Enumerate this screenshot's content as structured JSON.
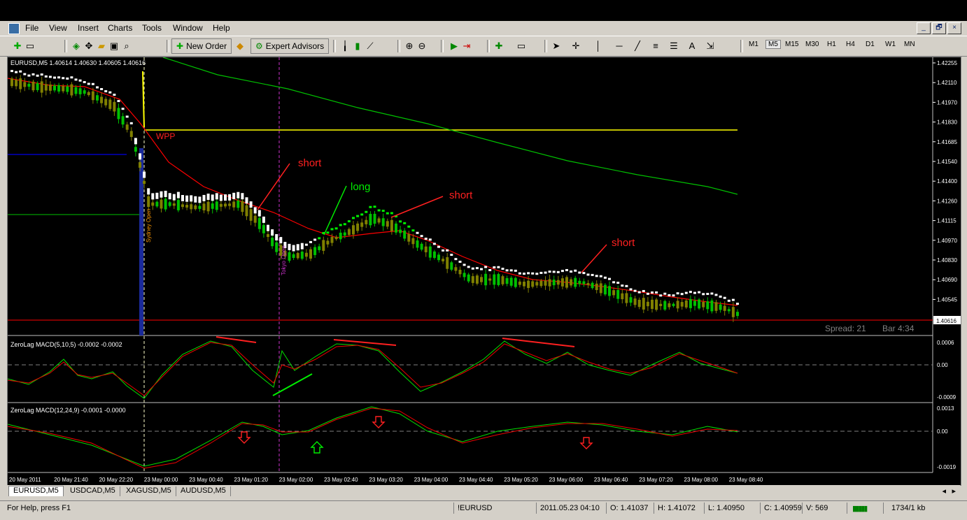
{
  "menu": [
    "File",
    "View",
    "Insert",
    "Charts",
    "Tools",
    "Window",
    "Help"
  ],
  "window_buttons": [
    "_",
    "🗗",
    "×"
  ],
  "toolbar": {
    "new_order": "New Order",
    "expert_advisors": "Expert Advisors",
    "timeframes": [
      "M1",
      "M5",
      "M15",
      "M30",
      "H1",
      "H4",
      "D1",
      "W1",
      "MN"
    ],
    "active_timeframe": "M5"
  },
  "chart": {
    "header": "EURUSD,M5  1.40614 1.40630 1.40605 1.40616",
    "price_labels": [
      "1.42255",
      "1.42110",
      "1.41970",
      "1.41830",
      "1.41685",
      "1.41540",
      "1.41400",
      "1.41260",
      "1.41115",
      "1.40970",
      "1.40830",
      "1.40690",
      "1.40545"
    ],
    "current_price": "1.40616",
    "spread_text": "Spread: 21",
    "bar_text": "Bar  4:34",
    "wpp_label": "WPP",
    "session_labels": [
      "Sydney Open",
      "Tokyo Open"
    ],
    "annotations": [
      "short",
      "long",
      "short",
      "short"
    ],
    "macd1_header": "ZeroLag MACD(5,10,5) -0.0002 -0.0002",
    "macd1_levels": [
      "0.0006",
      "0.00",
      "-0.0009"
    ],
    "macd2_header": "ZeroLag MACD(12,24,9) -0.0001 -0.0000",
    "macd2_levels": [
      "0.0013",
      "0.00",
      "-0.0019"
    ],
    "time_labels": [
      "20 May 2011",
      "20 May 21:40",
      "20 May 22:20",
      "23 May 00:00",
      "23 May 00:40",
      "23 May 01:20",
      "23 May 02:00",
      "23 May 02:40",
      "23 May 03:20",
      "23 May 04:00",
      "23 May 04:40",
      "23 May 05:20",
      "23 May 06:00",
      "23 May 06:40",
      "23 May 07:20",
      "23 May 08:00",
      "23 May 08:40"
    ]
  },
  "tabs": [
    "EURUSD,M5",
    "USDCAD,M5",
    "XAGUSD,M5",
    "AUDUSD,M5"
  ],
  "status": {
    "help": "For Help, press F1",
    "profile": "!EURUSD",
    "datetime": "2011.05.23 04:10",
    "open": "O: 1.41037",
    "high": "H: 1.41072",
    "low": "L: 1.40950",
    "close": "C: 1.40959",
    "volume": "V: 569",
    "traffic": "1734/1 kb"
  },
  "colors": {
    "up_candle": "#00c000",
    "down_candle": "#808000",
    "ma_red": "#ff0000",
    "ma_green": "#00ff00",
    "pivot": "#ffff00"
  }
}
